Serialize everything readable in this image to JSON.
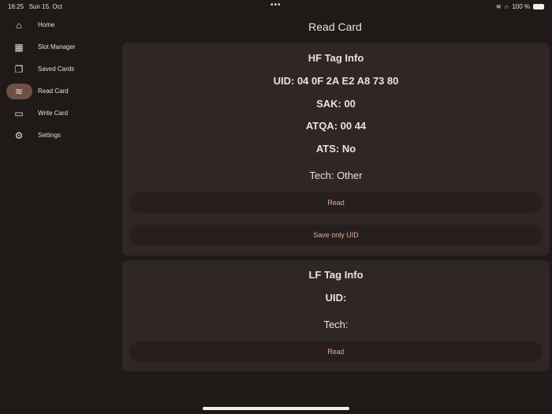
{
  "status": {
    "time": "16:25",
    "date": "Sun 15. Oct",
    "dots": "•••",
    "battery": "100 %"
  },
  "sidebar": {
    "items": [
      {
        "label": "Home",
        "icon": "⌂"
      },
      {
        "label": "Slot Manager",
        "icon": "▦"
      },
      {
        "label": "Saved Cards",
        "icon": "❐"
      },
      {
        "label": "Read Card",
        "icon": "≋"
      },
      {
        "label": "Write Card",
        "icon": "▭"
      },
      {
        "label": "Settings",
        "icon": "⚙"
      }
    ]
  },
  "page": {
    "title": "Read Card"
  },
  "hf": {
    "title": "HF Tag Info",
    "uid": "UID: 04 0F 2A E2 A8 73 80",
    "sak": "SAK: 00",
    "atqa": "ATQA: 00 44",
    "ats": "ATS: No",
    "tech": "Tech: Other",
    "read": "Read",
    "save": "Save only UID"
  },
  "lf": {
    "title": "LF Tag Info",
    "uid": "UID:",
    "tech": "Tech:",
    "read": "Read"
  },
  "colors": {
    "accent": "#e8a894",
    "background": "#1f1a18",
    "card": "#2e2725",
    "active": "#6d4f45"
  }
}
